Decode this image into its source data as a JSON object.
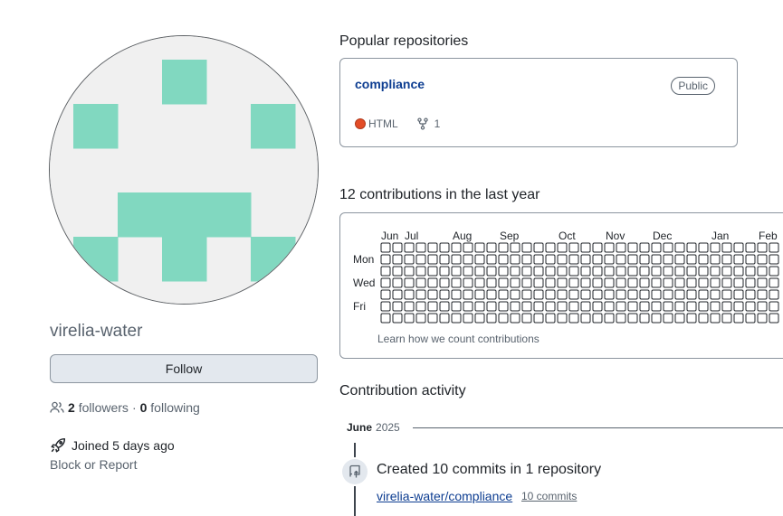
{
  "profile": {
    "username": "virelia-water",
    "follow_label": "Follow",
    "followers_count": "2",
    "followers_label": "followers",
    "separator": "·",
    "following_count": "0",
    "following_label": "following",
    "joined": "Joined 5 days ago",
    "block_report": "Block or Report",
    "avatar_color": "#81d8c0",
    "avatar_bg": "#f0f0f0"
  },
  "popular": {
    "title": "Popular repositories",
    "repos": [
      {
        "name": "compliance",
        "visibility": "Public",
        "language": "HTML",
        "language_color": "#e34c26",
        "forks": "1"
      }
    ]
  },
  "contributions": {
    "title": "12 contributions in the last year",
    "months": [
      "Jun",
      "Jul",
      "Aug",
      "Sep",
      "Oct",
      "Nov",
      "Dec",
      "Jan",
      "Feb"
    ],
    "days": [
      "Mon",
      "Wed",
      "Fri"
    ],
    "learn_link": "Learn how we count contributions"
  },
  "activity": {
    "title": "Contribution activity",
    "month": "June",
    "year": "2025",
    "summary": "Created 10 commits in 1 repository",
    "repo": "virelia-water/compliance",
    "commits": "10 commits"
  }
}
